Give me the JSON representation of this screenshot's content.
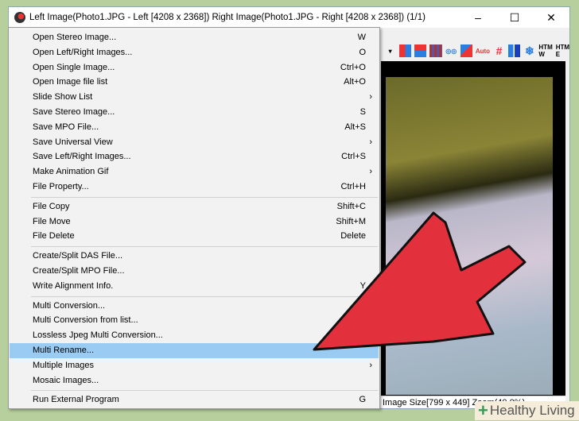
{
  "window": {
    "title": "Left Image(Photo1.JPG - Left [4208 x 2368]) Right Image(Photo1.JPG - Right [4208 x 2368])  (1/1)",
    "minimize": "–",
    "maximize": "☐",
    "close": "✕"
  },
  "toolbar": {
    "icons": [
      "dropdown-arrow",
      "side-by-side",
      "over-under",
      "interlaced",
      "anaglyph-glasses",
      "swap",
      "auto-align",
      "grid",
      "split",
      "freeze",
      "htm-w",
      "htm-e"
    ],
    "auto_label": "Auto",
    "htm_w": "HTM W",
    "htm_e": "HTM E"
  },
  "menu": {
    "groups": [
      [
        {
          "label": "Open Stereo Image...",
          "shortcut": "W"
        },
        {
          "label": "Open Left/Right Images...",
          "shortcut": "O"
        },
        {
          "label": "Open Single Image...",
          "shortcut": "Ctrl+O"
        },
        {
          "label": "Open Image file list",
          "shortcut": "Alt+O"
        },
        {
          "label": "Slide Show List",
          "submenu": "›"
        },
        {
          "label": "Save Stereo Image...",
          "shortcut": "S"
        },
        {
          "label": "Save MPO File...",
          "shortcut": "Alt+S"
        },
        {
          "label": "Save Universal View",
          "submenu": "›"
        },
        {
          "label": "Save Left/Right Images...",
          "shortcut": "Ctrl+S"
        },
        {
          "label": "Make Animation Gif",
          "submenu": "›"
        },
        {
          "label": "File  Property...",
          "shortcut": "Ctrl+H"
        }
      ],
      [
        {
          "label": "File Copy",
          "shortcut": "Shift+C"
        },
        {
          "label": "File Move",
          "shortcut": "Shift+M"
        },
        {
          "label": "File Delete",
          "shortcut": "Delete"
        }
      ],
      [
        {
          "label": "Create/Split DAS File..."
        },
        {
          "label": "Create/Split MPO File..."
        },
        {
          "label": "Write Alignment Info.",
          "shortcut": "Y"
        }
      ],
      [
        {
          "label": "Multi Conversion..."
        },
        {
          "label": "Multi Conversion from list..."
        },
        {
          "label": "Lossless Jpeg Multi Conversion..."
        },
        {
          "label": "Multi Rename...",
          "highlighted": true
        },
        {
          "label": "Multiple Images",
          "submenu": "›"
        },
        {
          "label": "Mosaic Images..."
        }
      ],
      [
        {
          "label": "Run External Program",
          "shortcut": "G"
        }
      ]
    ]
  },
  "status": {
    "text": "Image Size[799 x 449]  Zoom(40.0%)"
  },
  "watermark": {
    "text": "Healthy Living"
  },
  "colors": {
    "highlight": "#99cbf3",
    "arrow": "#e2303c",
    "background": "#b6cf9d"
  }
}
